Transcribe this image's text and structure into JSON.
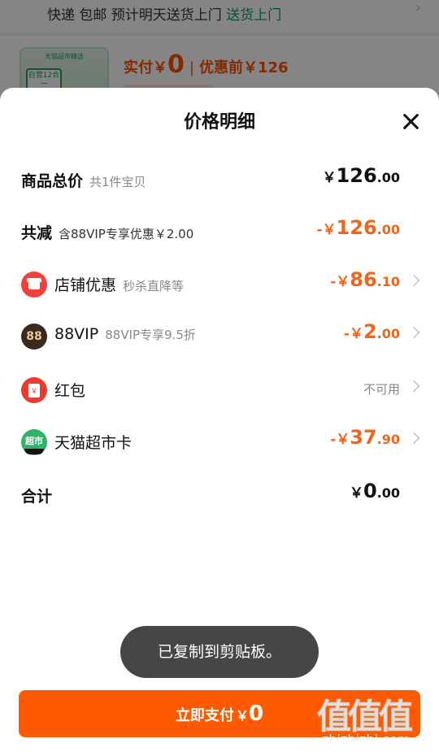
{
  "background": {
    "delivery_text": "快递 包邮  预计明天送货上门",
    "delivery_highlight": "送货上门",
    "thumb_top": "天猫超市精选",
    "thumb_tag": "自营12合一",
    "price_label": "实付￥",
    "price_value": "0",
    "original_label": "优惠前￥126"
  },
  "sheet": {
    "title": "价格明细",
    "rows": [
      {
        "label": "商品总价",
        "sub": "共1件宝贝",
        "yen": "￥",
        "int": "126",
        "dec": ".00"
      },
      {
        "label": "共减",
        "sub": "含88VIP专享优惠￥2.00",
        "yen": "-￥",
        "int": "126",
        "dec": ".00"
      },
      {
        "label": "店铺优惠",
        "sub": "秒杀直降等",
        "yen": "-￥",
        "int": "86",
        "dec": ".10",
        "icon": "shop-icon"
      },
      {
        "label": "88VIP",
        "sub": "88VIP专享9.5折",
        "yen": "-￥",
        "int": "2",
        "dec": ".00",
        "icon": "vip-88-icon",
        "icon_text": "88"
      },
      {
        "label": "红包",
        "status": "不可用",
        "icon": "red-packet-icon",
        "icon_text": "￥"
      },
      {
        "label": "天猫超市卡",
        "yen": "-￥",
        "int": "37",
        "dec": ".90",
        "icon": "tmall-supermarket-card-icon",
        "icon_text": "超市"
      },
      {
        "label": "合计",
        "yen": "￥",
        "int": "0",
        "dec": ".00"
      }
    ]
  },
  "toast": "已复制到剪贴板。",
  "pay_button": {
    "label": "立即支付",
    "yen": "￥",
    "value": "0"
  },
  "watermark": {
    "chars": "值值值",
    "url": "zhizhizhi.com"
  },
  "colors": {
    "accent": "#ff5a00",
    "discount": "#f0651b",
    "delivery_green": "#0a9e5a"
  }
}
